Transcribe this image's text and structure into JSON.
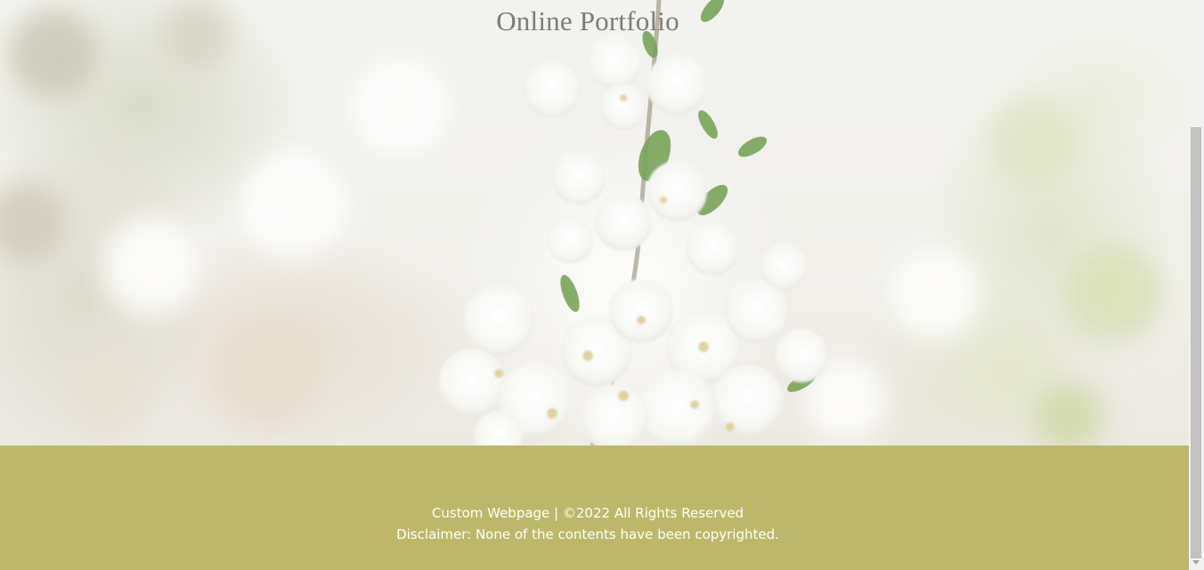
{
  "header": {
    "title": "Online Portfolio"
  },
  "hero": {
    "image_description_icon": "white-blossom-branch-image"
  },
  "footer": {
    "line1": "Custom Webpage | ©2022 All Rights Reserved",
    "line2": "Disclaimer: None of the contents have been copyrighted.",
    "background_color": "#bdb869",
    "text_color": "#ffffff"
  }
}
